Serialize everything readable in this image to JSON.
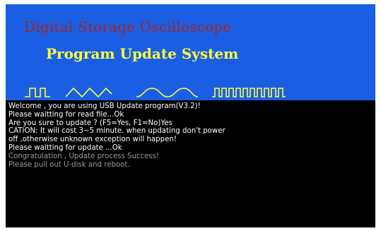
{
  "banner": {
    "title": "Digital Storage Oscilloscope",
    "subtitle": "Program Update System",
    "waveform_icons": [
      "square-wave-icon",
      "triangle-wave-icon",
      "sine-wave-icon",
      "pulse-train-icon"
    ]
  },
  "console": {
    "lines": [
      "Welcome , you are using USB Update program(V3.2)!",
      "Please waitting for read file...Ok",
      "Are you sure to update ? (F5=Yes, F1=No)Yes",
      "CATION: It will cost 3~5 minute. when updating don't power",
      "off ,otherwise unknown exception will happen!",
      "Please waitting for update ...Ok",
      "Congratulation , Update process Success!",
      "Please pull out U-disk and reboot."
    ]
  },
  "colors": {
    "banner_bg": "#1a5fe3",
    "title": "#a22424",
    "subtitle": "#ffff3c",
    "wave": "#ffff3c",
    "console_bg": "#000000",
    "console_text": "#ffffff",
    "console_dim_text": "#9a9a9a"
  }
}
